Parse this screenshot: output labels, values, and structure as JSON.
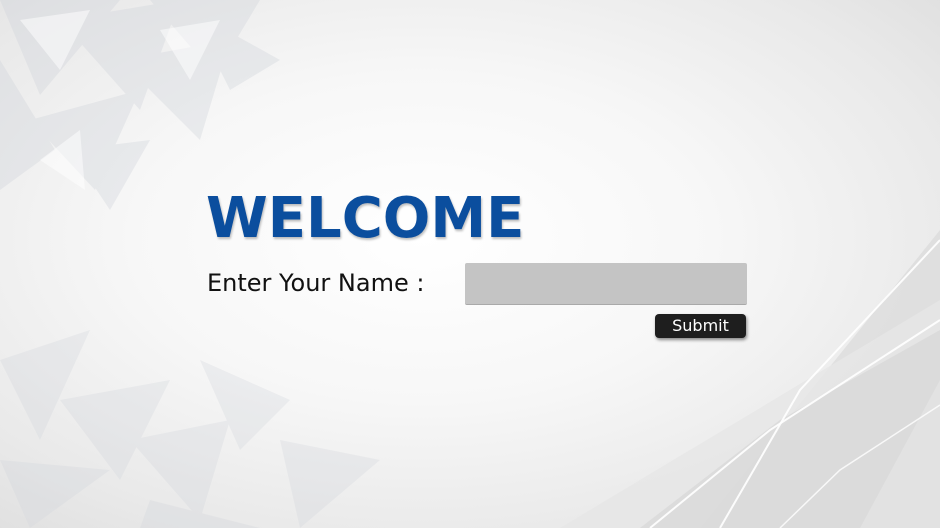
{
  "welcome": {
    "title": "WELCOME"
  },
  "form": {
    "label": "Enter Your Name :",
    "name_value": "",
    "name_placeholder": "",
    "submit_label": "Submit"
  },
  "colors": {
    "title": "#0b4e9e",
    "input_bg": "#c4c4c4",
    "button_bg": "#1e1e1e"
  }
}
